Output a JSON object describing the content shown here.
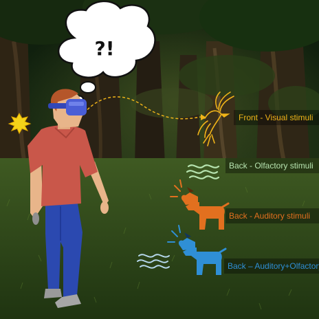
{
  "thought_bubble": {
    "text": "?!"
  },
  "stimuli": [
    {
      "label": "Front - Visual stimuli",
      "icon": "bird-icon",
      "color": "#f0b419"
    },
    {
      "label": "Back - Olfactory stimuli",
      "icon": "smell-waves-icon",
      "color": "#b7e4b0"
    },
    {
      "label": "Back - Auditory stimuli",
      "icon": "barking-dog-icon",
      "color": "#e2701f"
    },
    {
      "label": "Back – Auditory+Olfactory stimuli",
      "icon": "barking-dog-smell-icon",
      "color": "#2f8fd6"
    }
  ],
  "colors": {
    "visual": "#f0b419",
    "olfactory": "#b7e4b0",
    "auditory": "#e2701f",
    "combined": "#2f8fd6",
    "shirt": "#c9574a",
    "jeans": "#2b49b0",
    "headset": "#4a5ed6"
  }
}
